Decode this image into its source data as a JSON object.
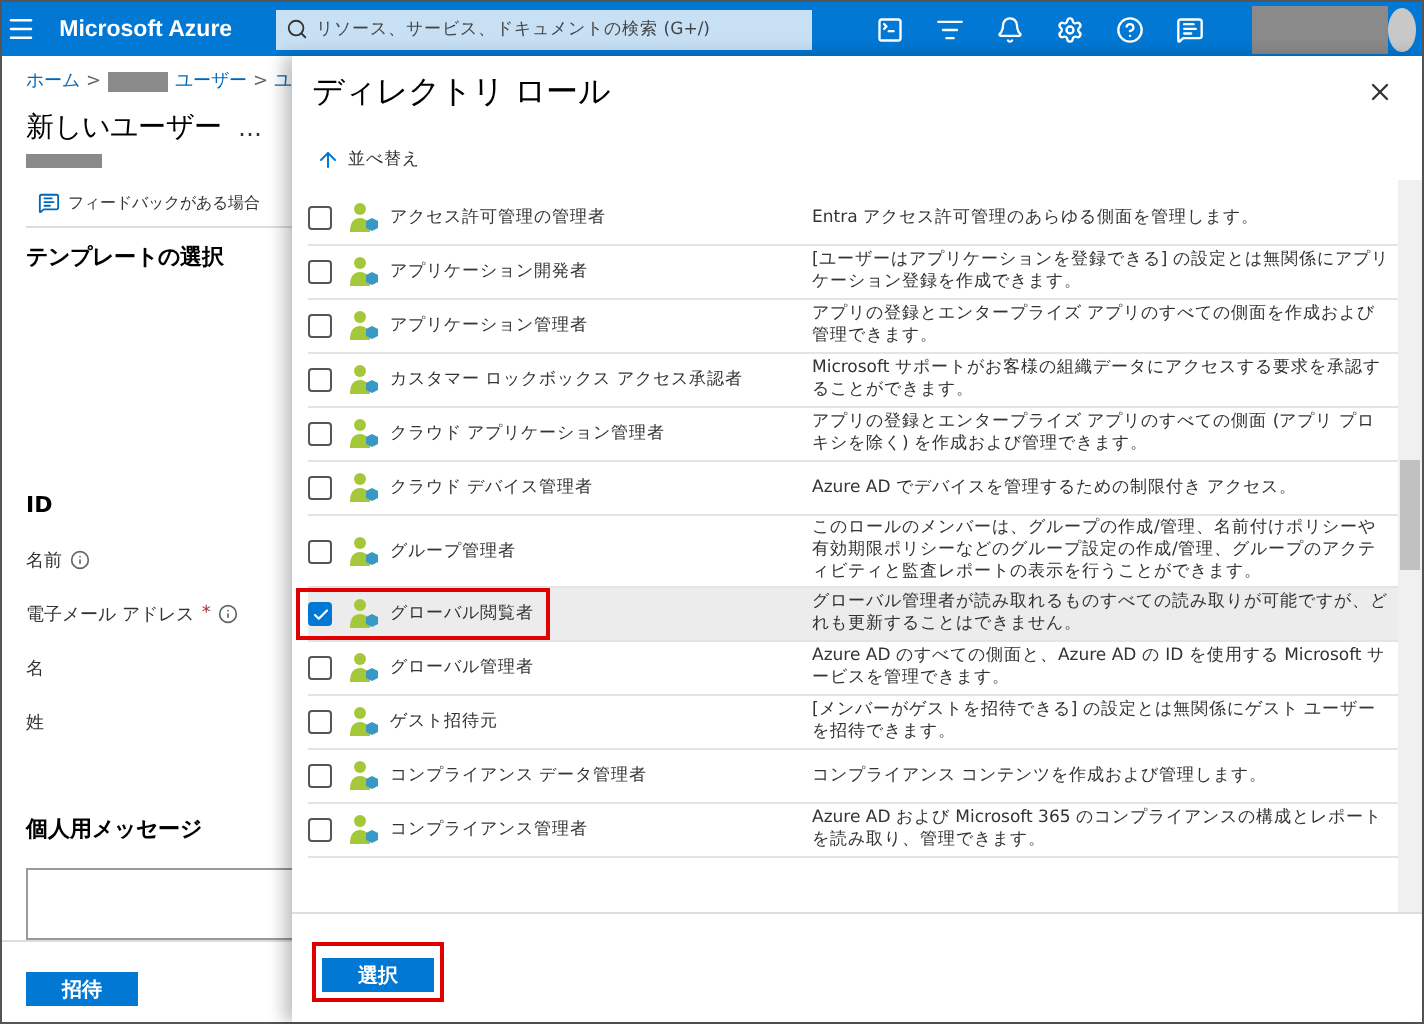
{
  "header": {
    "brand": "Microsoft Azure",
    "search": {
      "placeholder": "リソース、サービス、ドキュメントの検索 (G+/)"
    }
  },
  "breadcrumb": [
    {
      "kind": "link",
      "label": "ホーム"
    },
    {
      "kind": "separator",
      "label": ">"
    },
    {
      "kind": "redacted"
    },
    {
      "kind": "link",
      "label": "ユーザー"
    },
    {
      "kind": "separator",
      "label": ">"
    },
    {
      "kind": "link",
      "label": "ユ"
    }
  ],
  "page": {
    "title": "新しいユーザー",
    "more": "…",
    "feedback": "フィードバックがある場合",
    "template_heading": "テンプレートの選択",
    "id_heading": "ID",
    "fields": [
      {
        "label": "名前",
        "info": true
      },
      {
        "label": "電子メール アドレス",
        "required_mark": "*",
        "info": true
      },
      {
        "label": "名",
        "info": false
      },
      {
        "label": "姓",
        "info": false
      }
    ],
    "message_heading": "個人用メッセージ",
    "invite_button": "招待"
  },
  "dialog": {
    "title": "ディレクトリ ロール",
    "sort": "並べ替え",
    "roles": [
      {
        "name": "アクセス許可管理の管理者",
        "description": "Entra アクセス許可管理のあらゆる側面を管理します。",
        "selected": false,
        "highlighted": false
      },
      {
        "name": "アプリケーション開発者",
        "description": "[ユーザーはアプリケーションを登録できる] の設定とは無関係にアプリケーション登録を作成できます。",
        "selected": false,
        "highlighted": false
      },
      {
        "name": "アプリケーション管理者",
        "description": "アプリの登録とエンタープライズ アプリのすべての側面を作成および管理できます。",
        "selected": false,
        "highlighted": false
      },
      {
        "name": "カスタマー ロックボックス アクセス承認者",
        "description": "Microsoft サポートがお客様の組織データにアクセスする要求を承認することができます。",
        "selected": false,
        "highlighted": false
      },
      {
        "name": "クラウド アプリケーション管理者",
        "description": "アプリの登録とエンタープライズ アプリのすべての側面 (アプリ プロキシを除く) を作成および管理できます。",
        "selected": false,
        "highlighted": false
      },
      {
        "name": "クラウド デバイス管理者",
        "description": "Azure AD でデバイスを管理するための制限付き アクセス。",
        "selected": false,
        "highlighted": false
      },
      {
        "name": "グループ管理者",
        "description": "このロールのメンバーは、グループの作成/管理、名前付けポリシーや有効期限ポリシーなどのグループ設定の作成/管理、グループのアクティビティと監査レポートの表示を行うことができます。",
        "selected": false,
        "highlighted": false
      },
      {
        "name": "グローバル閲覧者",
        "description": "グローバル管理者が読み取れるものすべての読み取りが可能ですが、どれも更新することはできません。",
        "selected": true,
        "highlighted": true
      },
      {
        "name": "グローバル管理者",
        "description": "Azure AD のすべての側面と、Azure AD の ID を使用する Microsoft サービスを管理できます。",
        "selected": false,
        "highlighted": false
      },
      {
        "name": "ゲスト招待元",
        "description": "[メンバーがゲストを招待できる] の設定とは無関係にゲスト ユーザーを招待できます。",
        "selected": false,
        "highlighted": false
      },
      {
        "name": "コンプライアンス データ管理者",
        "description": "コンプライアンス コンテンツを作成および管理します。",
        "selected": false,
        "highlighted": false
      },
      {
        "name": "コンプライアンス管理者",
        "description": "Azure AD および Microsoft 365 のコンプライアンスの構成とレポートを読み取り、管理できます。",
        "selected": false,
        "highlighted": false
      }
    ],
    "select_button": {
      "label": "選択",
      "highlighted": true
    }
  }
}
